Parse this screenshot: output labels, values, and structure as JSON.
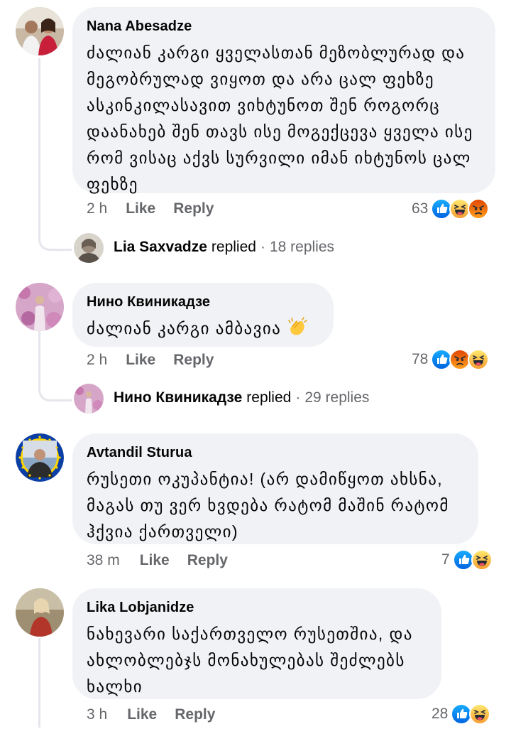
{
  "comments": [
    {
      "author": "Nana Abesadze",
      "text": "ძალიან კარგი ყველასთან მეზობლურად და მეგობრულად ვიყოთ და არა ცალ ფეხზე ასკინკილასავით ვიხტუნოთ შენ როგორც დაანახებ შენ თავს ისე მოგექცევა ყველა ისე რომ ვისაც აქვს სურვილი იმან იხტუნოს ცალ ფეხზე",
      "time": "2 h",
      "like": "Like",
      "reply": "Reply",
      "reaction_count": "63",
      "reactions": [
        "like-icon",
        "haha-icon",
        "angry-icon"
      ],
      "replies_summary": {
        "name": "Lia Saxvadze",
        "word": "replied",
        "count": "18 replies"
      }
    },
    {
      "author": "Нино Квиникадзе",
      "text": "ძალიან კარგი ამბავია",
      "time": "2 h",
      "like": "Like",
      "reply": "Reply",
      "reaction_count": "78",
      "reactions": [
        "like-icon",
        "angry-icon",
        "haha-icon"
      ],
      "replies_summary": {
        "name": "Нино Квиникадзе",
        "word": "replied",
        "count": "29 replies"
      }
    },
    {
      "author": "Avtandil Sturua",
      "text": "რუსეთი ოკუპანტია! (არ დამიწყოთ ახსნა, მაგას თუ ვერ ხვდება რატომ მაშინ რატომ ჰქვია ქართველი)",
      "time": "38 m",
      "like": "Like",
      "reply": "Reply",
      "reaction_count": "7",
      "reactions": [
        "like-icon",
        "haha-icon"
      ]
    },
    {
      "author": "Lika Lobjanidze",
      "text": "ნახევარი საქართველო რუსეთშია, და ახლობლებჯს მონახულებას შეძლებს ხალხი",
      "time": "3 h",
      "like": "Like",
      "reply": "Reply",
      "reaction_count": "28",
      "reactions": [
        "like-icon",
        "haha-icon"
      ]
    }
  ],
  "colors": {
    "bubble": "#f0f2f5",
    "meta": "#65676b",
    "like_blue": "#1877f2",
    "thread_line": "#e4e6eb"
  }
}
